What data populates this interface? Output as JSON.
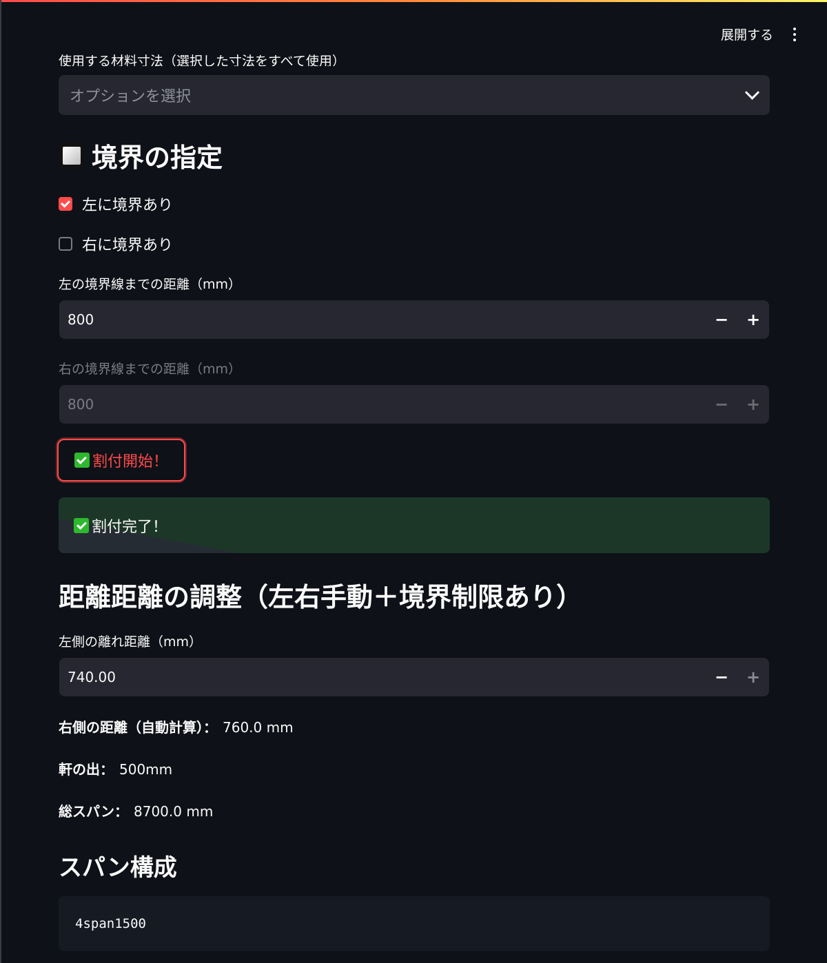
{
  "header": {
    "expand_label": "展開する"
  },
  "cut_section": {
    "label": "使用する材料寸法（選択した寸法をすべて使用）",
    "select_placeholder": "オプションを選択"
  },
  "boundary": {
    "heading": "境界の指定",
    "left_checkbox": {
      "label": "左に境界あり",
      "checked": true
    },
    "right_checkbox": {
      "label": "右に境界あり",
      "checked": false
    },
    "left_distance": {
      "label": "左の境界線までの距離（mm）",
      "value": "800"
    },
    "right_distance": {
      "label": "右の境界線までの距離（mm）",
      "value": "800",
      "disabled": true
    },
    "minus": "−",
    "plus": "+"
  },
  "start_button": {
    "label": "割付開始！"
  },
  "success": {
    "message": "割付完了！"
  },
  "distance": {
    "heading": "距離距離の調整（左右手動＋境界制限あり）",
    "left_gap": {
      "label": "左側の離れ距離（mm）",
      "value": "740.00"
    },
    "right_auto": {
      "label": "右側の距離（自動計算）：",
      "value": "760.0 mm"
    },
    "eave": {
      "label": "軒の出：",
      "value": "500mm"
    },
    "total_span": {
      "label": "総スパン：",
      "value": "8700.0 mm"
    }
  },
  "span": {
    "heading": "スパン構成",
    "code": "4span1500"
  },
  "colors": {
    "accent": "#ff4b4b",
    "background": "#0e1117",
    "success_bg": "#1c3728"
  }
}
